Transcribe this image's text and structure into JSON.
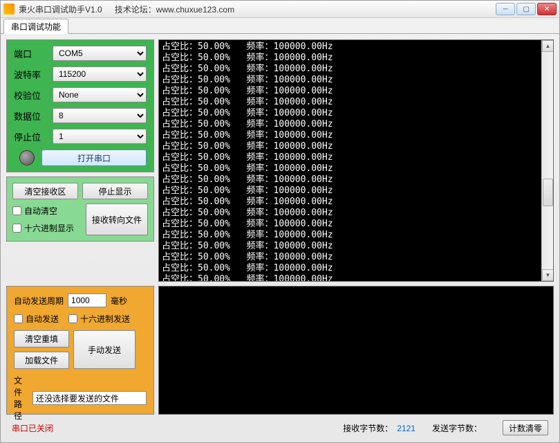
{
  "window": {
    "title": "秉火串口调试助手V1.0",
    "forum_label": "技术论坛：",
    "forum_url": "www.chuxue123.com"
  },
  "tabs": {
    "main": "串口调试功能"
  },
  "config": {
    "port_label": "端口",
    "port_value": "COM5",
    "baud_label": "波特率",
    "baud_value": "115200",
    "parity_label": "校验位",
    "parity_value": "None",
    "databits_label": "数据位",
    "databits_value": "8",
    "stopbits_label": "停止位",
    "stopbits_value": "1",
    "open_button": "打开串口"
  },
  "recv": {
    "clear_btn": "清空接收区",
    "stop_btn": "停止显示",
    "auto_clear": "自动清空",
    "hex_display": "十六进制显示",
    "to_file_btn": "接收转向文件"
  },
  "send": {
    "period_label": "自动发送周期",
    "period_value": "1000",
    "period_unit": "毫秒",
    "auto_send": "自动发送",
    "hex_send": "十六进制发送",
    "clear_btn": "清空重填",
    "load_btn": "加载文件",
    "manual_btn": "手动发送",
    "filepath_label": "文件路径",
    "filepath_value": "还没选择要发送的文件"
  },
  "status": {
    "port_state": "串口已关闭",
    "recv_label": "接收字节数：",
    "recv_count": "2121",
    "send_label": "发送字节数：",
    "send_count": "",
    "reset_btn": "计数清零"
  },
  "console_line": "占空比：50.00%   频率：100000.00Hz",
  "console_line_count": 22
}
